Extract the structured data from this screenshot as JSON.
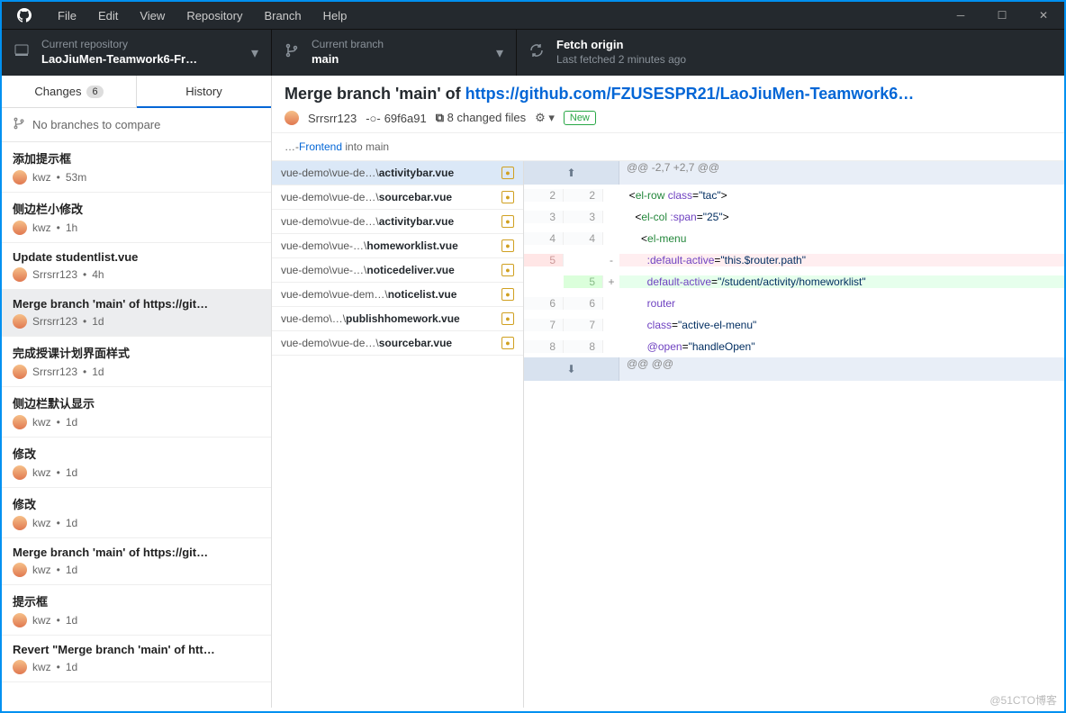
{
  "menubar": {
    "items": [
      "File",
      "Edit",
      "View",
      "Repository",
      "Branch",
      "Help"
    ]
  },
  "toolbar": {
    "repo": {
      "sub": "Current repository",
      "main": "LaoJiuMen-Teamwork6-Fr…"
    },
    "branch": {
      "sub": "Current branch",
      "main": "main"
    },
    "fetch": {
      "main": "Fetch origin",
      "sub": "Last fetched 2 minutes ago"
    }
  },
  "tabs": {
    "changes": "Changes",
    "changes_count": "6",
    "history": "History"
  },
  "compare_bar": "No branches to compare",
  "commits": [
    {
      "title": "添加提示框",
      "author": "kwz",
      "time": "53m"
    },
    {
      "title": "侧边栏小修改",
      "author": "kwz",
      "time": "1h"
    },
    {
      "title": "Update studentlist.vue",
      "author": "Srrsrr123",
      "time": "4h"
    },
    {
      "title": "Merge branch 'main' of https://git…",
      "author": "Srrsrr123",
      "time": "1d",
      "selected": true
    },
    {
      "title": "完成授课计划界面样式",
      "author": "Srrsrr123",
      "time": "1d"
    },
    {
      "title": "侧边栏默认显示",
      "author": "kwz",
      "time": "1d"
    },
    {
      "title": "修改",
      "author": "kwz",
      "time": "1d"
    },
    {
      "title": "修改",
      "author": "kwz",
      "time": "1d"
    },
    {
      "title": "Merge branch 'main' of https://git…",
      "author": "kwz",
      "time": "1d"
    },
    {
      "title": "提示框",
      "author": "kwz",
      "time": "1d"
    },
    {
      "title": "Revert \"Merge branch 'main' of htt…",
      "author": "kwz",
      "time": "1d"
    }
  ],
  "commit_detail": {
    "title_prefix": "Merge branch 'main' of ",
    "title_link": "https://github.com/FZUSESPR21/LaoJiuMen-Teamwork6…",
    "author": "Srrsrr123",
    "sha": "69f6a91",
    "changed": "8 changed files",
    "pill": "New",
    "desc_pre": "…-",
    "desc_hl": "Frontend",
    "desc_post": " into main"
  },
  "files": [
    {
      "path": "vue-demo\\vue-de…\\",
      "name": "activitybar.vue",
      "selected": true
    },
    {
      "path": "vue-demo\\vue-de…\\",
      "name": "sourcebar.vue"
    },
    {
      "path": "vue-demo\\vue-de…\\",
      "name": "activitybar.vue"
    },
    {
      "path": "vue-demo\\vue-…\\",
      "name": "homeworklist.vue"
    },
    {
      "path": "vue-demo\\vue-…\\",
      "name": "noticedeliver.vue"
    },
    {
      "path": "vue-demo\\vue-dem…\\",
      "name": "noticelist.vue"
    },
    {
      "path": "vue-demo\\…\\",
      "name": "publishhomework.vue"
    },
    {
      "path": "vue-demo\\vue-de…\\",
      "name": "sourcebar.vue"
    }
  ],
  "diff": {
    "hunk": "@@ -2,7 +2,7 @@",
    "lines": [
      {
        "a": "2",
        "b": "2",
        "t": "ctx",
        "html": "  &lt;<span class='kw'>el-row</span> <span class='attr'>class</span>=<span class='str'>\"tac\"</span>&gt;"
      },
      {
        "a": "3",
        "b": "3",
        "t": "ctx",
        "html": "    &lt;<span class='kw'>el-col</span> <span class='attr'>:span</span>=<span class='str'>\"25\"</span>&gt;"
      },
      {
        "a": "4",
        "b": "4",
        "t": "ctx",
        "html": "      &lt;<span class='kw'>el-menu</span>"
      },
      {
        "a": "5",
        "b": "",
        "t": "del",
        "html": "        <span class='attr'>:default-active</span>=<span class='str'>\"this.$router.path\"</span>"
      },
      {
        "a": "",
        "b": "5",
        "t": "add",
        "html": "        <span class='attr'>default-active</span>=<span class='str'>\"/student/activity/homeworklist\"</span>"
      },
      {
        "a": "6",
        "b": "6",
        "t": "ctx",
        "html": "        <span class='attr'>router</span>"
      },
      {
        "a": "7",
        "b": "7",
        "t": "ctx",
        "html": "        <span class='attr'>class</span>=<span class='str'>\"active-el-menu\"</span>"
      },
      {
        "a": "8",
        "b": "8",
        "t": "ctx",
        "html": "        <span class='attr'>@open</span>=<span class='str'>\"handleOpen\"</span>"
      }
    ],
    "hunk2": "@@ @@"
  },
  "watermark": "@51CTO博客"
}
